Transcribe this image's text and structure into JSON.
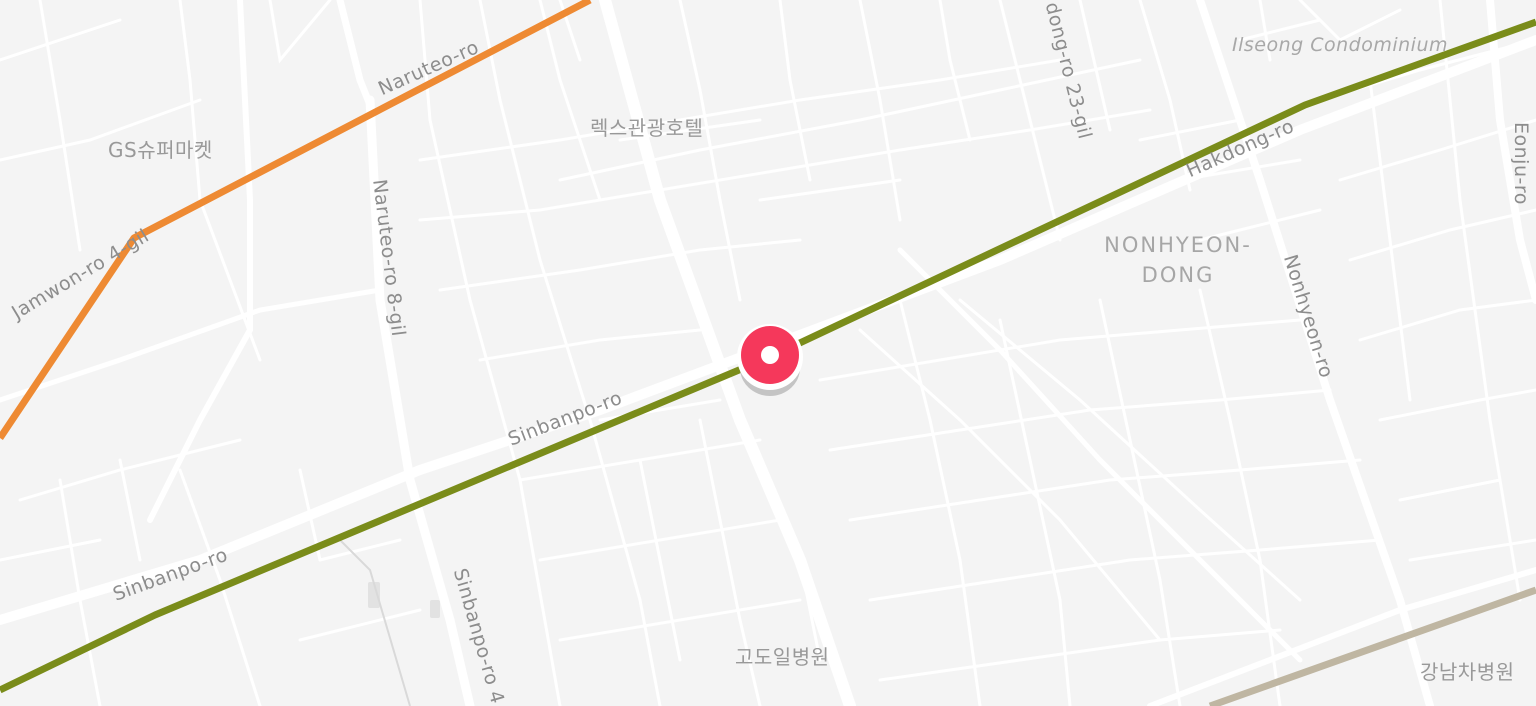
{
  "map": {
    "colors": {
      "background": "#f4f4f4",
      "road": "#ffffff",
      "line_orange": "#ee8a33",
      "line_olive": "#7a8c1a",
      "line_tan": "#bfb6a2",
      "marker": "#f5385b"
    },
    "labels": {
      "naruteo_ro": "Naruteo-ro",
      "jamwon_ro_4gil": "Jamwon-ro 4-gil",
      "gs_supermarket_prefix": "GS",
      "gs_supermarket_suffix": "슈퍼마켓",
      "naruteo_ro_8gil": "Naruteo-ro 8-gil",
      "rex_hotel": "렉스관광호텔",
      "dong_ro_23gil": "dong-ro 23-gil",
      "ilseong_condominium": "Ilseong Condominium",
      "hakdong_ro": "Hakdong-ro",
      "eonju_ro": "Eonju-ro",
      "nonhyeon_dong_1": "NONHYEON-",
      "nonhyeon_dong_2": "DONG",
      "nonhyeon_ro": "Nonhyeon-ro",
      "sinbanpo_ro_upper": "Sinbanpo-ro",
      "sinbanpo_ro_lower": "Sinbanpo-ro",
      "sinbanpo_ro_4": "Sinbanpo-ro 4",
      "godoil_hospital": "고도일병원",
      "gangnam_cha_hospital": "강남차병원"
    },
    "marker": {
      "type": "location-pin",
      "icon": "map-pin-icon"
    }
  }
}
